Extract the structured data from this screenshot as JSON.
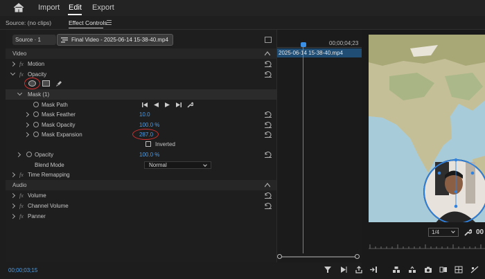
{
  "menu": {
    "home_icon": "home-icon",
    "items": [
      {
        "label": "Import",
        "active": false
      },
      {
        "label": "Edit",
        "active": true
      },
      {
        "label": "Export",
        "active": false
      }
    ]
  },
  "panel_tabs": {
    "source_tab": "Source: (no clips)",
    "effect_controls_tab": "Effect Controls"
  },
  "effect_controls": {
    "source_button": "Source · 1",
    "clip_button": "Final Video - 2025-06-14 15-38-40.mp4",
    "video_section": "Video",
    "audio_section": "Audio",
    "rows": {
      "motion": "Motion",
      "opacity": "Opacity",
      "mask": "Mask (1)",
      "mask_path": "Mask Path",
      "mask_feather": {
        "label": "Mask Feather",
        "value": "10.0"
      },
      "mask_opacity": {
        "label": "Mask Opacity",
        "value": "100.0 %"
      },
      "mask_expansion": {
        "label": "Mask Expansion",
        "value": "287.0"
      },
      "inverted": {
        "label": "Inverted",
        "checked": false
      },
      "opacity_prop": {
        "label": "Opacity",
        "value": "100.0 %"
      },
      "blend_mode": {
        "label": "Blend Mode",
        "value": "Normal"
      },
      "time_remapping": "Time Remapping",
      "volume": "Volume",
      "channel_volume": "Channel Volume",
      "panner": "Panner"
    },
    "current_time": "00;00;03;15"
  },
  "timeline": {
    "end_time": "00;00;04;23",
    "clip_label": "2025-06-14 15-38-40.mp4"
  },
  "program_monitor": {
    "zoom": "1/4",
    "timecode": "00"
  },
  "colors": {
    "accent_blue": "#4d9ee9",
    "clip_blue": "#1f4d73",
    "annotation_red": "#d23030"
  }
}
